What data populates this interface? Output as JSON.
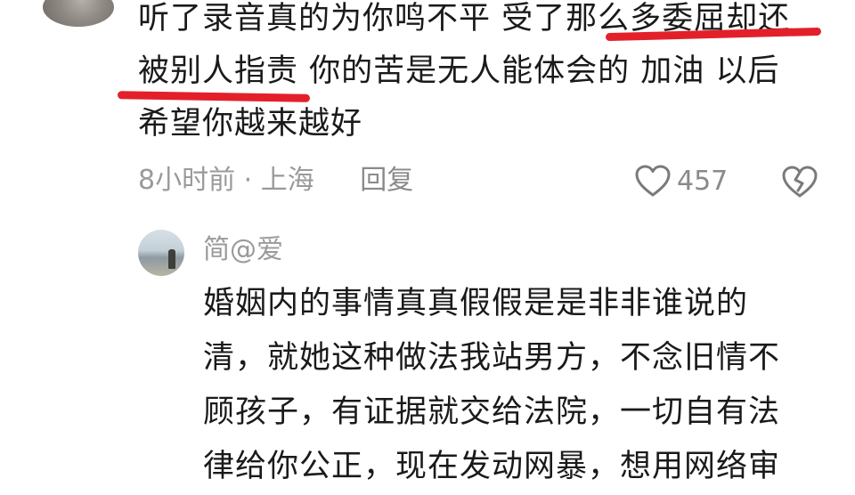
{
  "comment": {
    "lines": [
      "听了录音真的为你鸣不平 受了那么多委屈却还",
      "被别人指责 你的苦是无人能体会的 加油 以后",
      "希望你越来越好"
    ],
    "time": "8小时前",
    "separator": "·",
    "location": "上海",
    "reply_label": "回复",
    "like_count": "457",
    "highlight_color": "#e3202a"
  },
  "reply": {
    "author": "简@爱",
    "lines": [
      "婚姻内的事情真真假假是是非非谁说的",
      "清，就她这种做法我站男方，不念旧情不",
      "顾孩子，有证据就交给法院，一切自有法",
      "律给你公正，现在发动网暴，想用网络审"
    ]
  },
  "icons": {
    "like": "heart-outline-icon",
    "dislike": "broken-heart-icon"
  }
}
